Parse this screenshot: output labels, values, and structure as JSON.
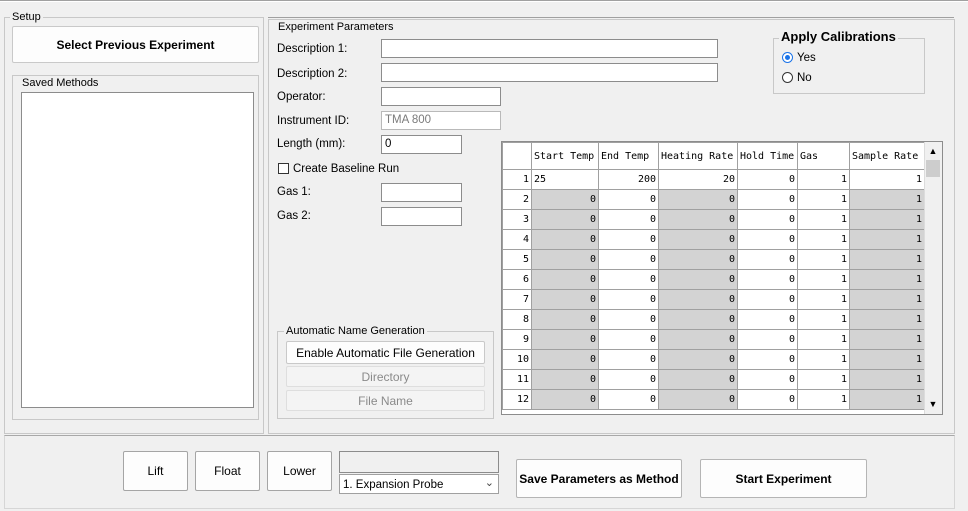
{
  "setup": {
    "title": "Setup",
    "select_previous_label": "Select Previous Experiment",
    "saved_methods_title": "Saved Methods"
  },
  "experiment": {
    "title": "Experiment Parameters",
    "desc1_label": "Description 1:",
    "desc1_value": "",
    "desc2_label": "Description 2:",
    "desc2_value": "",
    "operator_label": "Operator:",
    "operator_value": "",
    "instrument_label": "Instrument ID:",
    "instrument_value": "TMA 800",
    "length_label": "Length (mm):",
    "length_value": "0",
    "baseline_label": "Create Baseline Run",
    "gas1_label": "Gas 1:",
    "gas1_value": "",
    "gas2_label": "Gas 2:",
    "gas2_value": ""
  },
  "calibrations": {
    "title": "Apply Calibrations",
    "yes_label": "Yes",
    "no_label": "No",
    "selected": "Yes"
  },
  "auto_name": {
    "title": "Automatic Name Generation",
    "enable_label": "Enable Automatic File Generation",
    "directory_label": "Directory",
    "filename_label": "File Name"
  },
  "table": {
    "columns": [
      "Start Temp",
      "End Temp",
      "Heating Rate",
      "Hold Time",
      "Gas",
      "Sample Rate"
    ],
    "rows": [
      {
        "n": "1",
        "start": "25",
        "end": "200",
        "rate": "20",
        "hold": "0",
        "gas": "1",
        "sample": "1"
      },
      {
        "n": "2",
        "start": "0",
        "end": "0",
        "rate": "0",
        "hold": "0",
        "gas": "1",
        "sample": "1"
      },
      {
        "n": "3",
        "start": "0",
        "end": "0",
        "rate": "0",
        "hold": "0",
        "gas": "1",
        "sample": "1"
      },
      {
        "n": "4",
        "start": "0",
        "end": "0",
        "rate": "0",
        "hold": "0",
        "gas": "1",
        "sample": "1"
      },
      {
        "n": "5",
        "start": "0",
        "end": "0",
        "rate": "0",
        "hold": "0",
        "gas": "1",
        "sample": "1"
      },
      {
        "n": "6",
        "start": "0",
        "end": "0",
        "rate": "0",
        "hold": "0",
        "gas": "1",
        "sample": "1"
      },
      {
        "n": "7",
        "start": "0",
        "end": "0",
        "rate": "0",
        "hold": "0",
        "gas": "1",
        "sample": "1"
      },
      {
        "n": "8",
        "start": "0",
        "end": "0",
        "rate": "0",
        "hold": "0",
        "gas": "1",
        "sample": "1"
      },
      {
        "n": "9",
        "start": "0",
        "end": "0",
        "rate": "0",
        "hold": "0",
        "gas": "1",
        "sample": "1"
      },
      {
        "n": "10",
        "start": "0",
        "end": "0",
        "rate": "0",
        "hold": "0",
        "gas": "1",
        "sample": "1"
      },
      {
        "n": "11",
        "start": "0",
        "end": "0",
        "rate": "0",
        "hold": "0",
        "gas": "1",
        "sample": "1"
      },
      {
        "n": "12",
        "start": "0",
        "end": "0",
        "rate": "0",
        "hold": "0",
        "gas": "1",
        "sample": "1"
      }
    ]
  },
  "bottom": {
    "lift_label": "Lift",
    "float_label": "Float",
    "lower_label": "Lower",
    "status_text": "",
    "probe_selected": "1. Expansion Probe",
    "save_method_label": "Save Parameters as Method",
    "start_label": "Start Experiment"
  },
  "colors": {
    "accent": "#1a73e8",
    "disabled_cell": "#d3d3d3"
  }
}
